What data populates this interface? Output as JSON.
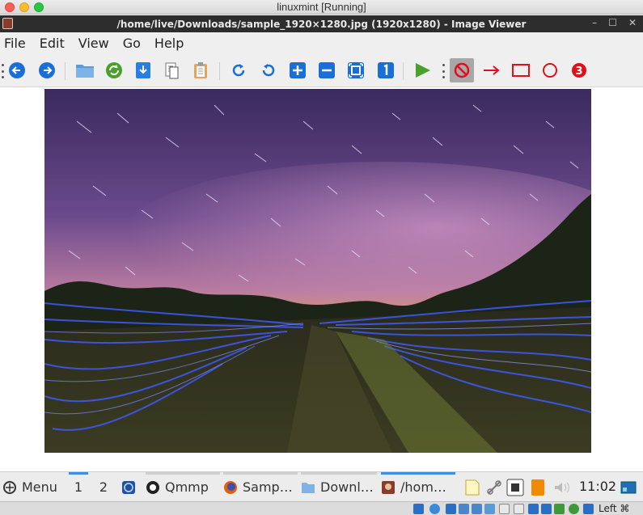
{
  "host": {
    "title": "linuxmint [Running]"
  },
  "window": {
    "title": "/home/live/Downloads/sample_1920×1280.jpg (1920x1280) - Image Viewer",
    "controls": [
      "–",
      "☐",
      "✕"
    ]
  },
  "menu": [
    "File",
    "Edit",
    "View",
    "Go",
    "Help"
  ],
  "toolbar": {
    "icons": [
      "back-icon",
      "forward-icon",
      "folder-icon",
      "reload-icon",
      "save-icon",
      "copy-icon",
      "paste-icon",
      "rotate-right-icon",
      "rotate-left-icon",
      "zoom-in-icon",
      "zoom-out-icon",
      "fit-icon",
      "actual-size-icon",
      "slideshow-icon",
      "no-annotation-icon",
      "arrow-annotation-icon",
      "rectangle-annotation-icon",
      "circle-annotation-icon",
      "number-annotation-icon"
    ],
    "number_badge": "3",
    "accent": "#1a6fd6"
  },
  "taskbar": {
    "menu_label": "Menu",
    "workspaces": [
      "1",
      "2"
    ],
    "tasks": [
      {
        "label": "Qmmp"
      },
      {
        "label": "Samp…"
      },
      {
        "label": "Downl…"
      },
      {
        "label": "/hom…"
      }
    ],
    "clock": "11:02"
  },
  "vbox": {
    "host_key": "Left ⌘"
  }
}
